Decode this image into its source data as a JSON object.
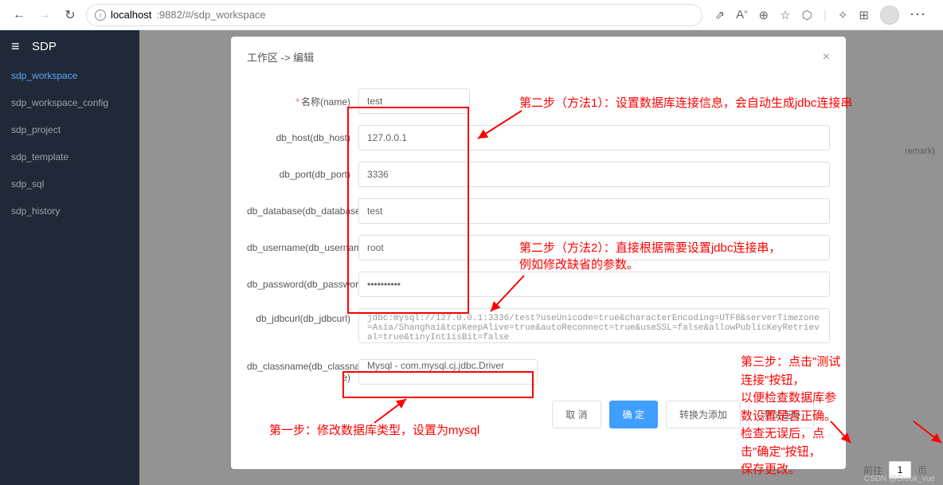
{
  "browser": {
    "url_prefix": "localhost",
    "url_rest": ":9882/#/sdp_workspace"
  },
  "app": {
    "title": "SDP"
  },
  "sidebar": {
    "items": [
      {
        "label": "sdp_workspace",
        "active": true
      },
      {
        "label": "sdp_workspace_config",
        "active": false
      },
      {
        "label": "sdp_project",
        "active": false
      },
      {
        "label": "sdp_template",
        "active": false
      },
      {
        "label": "sdp_sql",
        "active": false
      },
      {
        "label": "sdp_history",
        "active": false
      }
    ]
  },
  "modal": {
    "title": "工作区 -> 编辑",
    "fields": {
      "name": {
        "label": "名称(name)",
        "value": "test",
        "required": true
      },
      "db_host": {
        "label": "db_host(db_host)",
        "value": "127.0.0.1"
      },
      "db_port": {
        "label": "db_port(db_port)",
        "value": "3336"
      },
      "db_database": {
        "label": "db_database(db_database)",
        "value": "test"
      },
      "db_username": {
        "label": "db_username(db_username)",
        "value": "root"
      },
      "db_password": {
        "label": "db_password(db_password)",
        "value": "••••••••••"
      },
      "db_jdbcurl": {
        "label": "db_jdbcurl(db_jdbcurl)",
        "value": "jdbc:mysql://127.0.0.1:3336/test?useUnicode=true&characterEncoding=UTF8&serverTimezone=Asia/Shanghai&tcpKeepAlive=true&autoReconnect=true&useSSL=false&allowPublicKeyRetrieval=true&tinyInt1isBit=false"
      },
      "db_classname": {
        "label": "db_classname(db_classname)",
        "value": "Mysql - com.mysql.cj.jdbc.Driver"
      }
    },
    "buttons": {
      "cancel": "取 消",
      "confirm": "确 定",
      "convert": "转换为添加",
      "test": "测试连接"
    }
  },
  "annotations": {
    "step1": "第一步：修改数据库类型，设置为mysql",
    "step2a": "第二步（方法1）：设置数据库连接信息，会自动生成jdbc连接串",
    "step2b_l1": "第二步（方法2）：直接根据需要设置jdbc连接串，",
    "step2b_l2": "例如修改缺省的参数。",
    "step3_l1": "第三步：点击\"测试连接\"按钮，",
    "step3_l2": "以便检查数据库参数设置是否正确。",
    "step3_l3": "检查无误后，点击\"确定\"按钮，",
    "step3_l4": "保存更改。"
  },
  "pagination": {
    "prefix": "前往",
    "page": "1",
    "suffix": "页"
  },
  "remark_col": "remark)",
  "watermark": "CSDN @Brook_vue"
}
